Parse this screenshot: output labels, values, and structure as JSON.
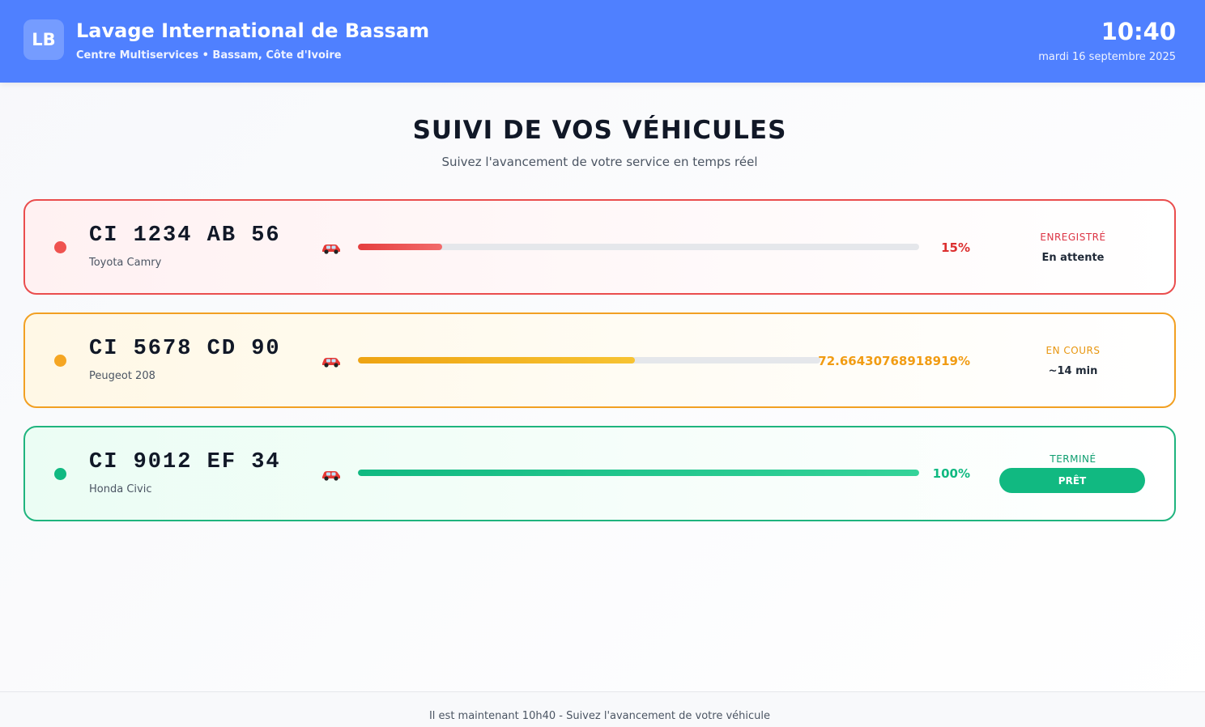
{
  "header": {
    "logo": "LB",
    "title": "Lavage International de Bassam",
    "subtitle": "Centre Multiservices • Bassam, Côte d'Ivoire",
    "time": "10:40",
    "date": "mardi 16 septembre 2025",
    "color": "#4f80ff"
  },
  "main": {
    "title": "SUIVI DE VOS VÉHICULES",
    "subtitle": "Suivez l'avancement de votre service en temps réel"
  },
  "vehicles": [
    {
      "plate": "CI 1234 AB 56",
      "model": "Toyota Camry",
      "icon": "car-icon",
      "progress_pct": 15,
      "progress_label": "15%",
      "status": "ENREGISTRÉ",
      "detail": "En attente",
      "color": "#ea4d4d"
    },
    {
      "plate": "CI 5678 CD 90",
      "model": "Peugeot 208",
      "icon": "car-icon",
      "progress_pct": 59.9,
      "progress_label": "72.66430768918919%",
      "status": "EN COURS",
      "detail": "~14 min",
      "color": "#f2a022"
    },
    {
      "plate": "CI 9012 EF 34",
      "model": "Honda Civic",
      "icon": "car-icon",
      "progress_pct": 100,
      "progress_label": "100%",
      "status": "TERMINÉ",
      "button": "PRÊT",
      "color": "#1fb47e"
    }
  ],
  "footer": {
    "text": "Il est maintenant 10h40 - Suivez l'avancement de votre véhicule"
  }
}
